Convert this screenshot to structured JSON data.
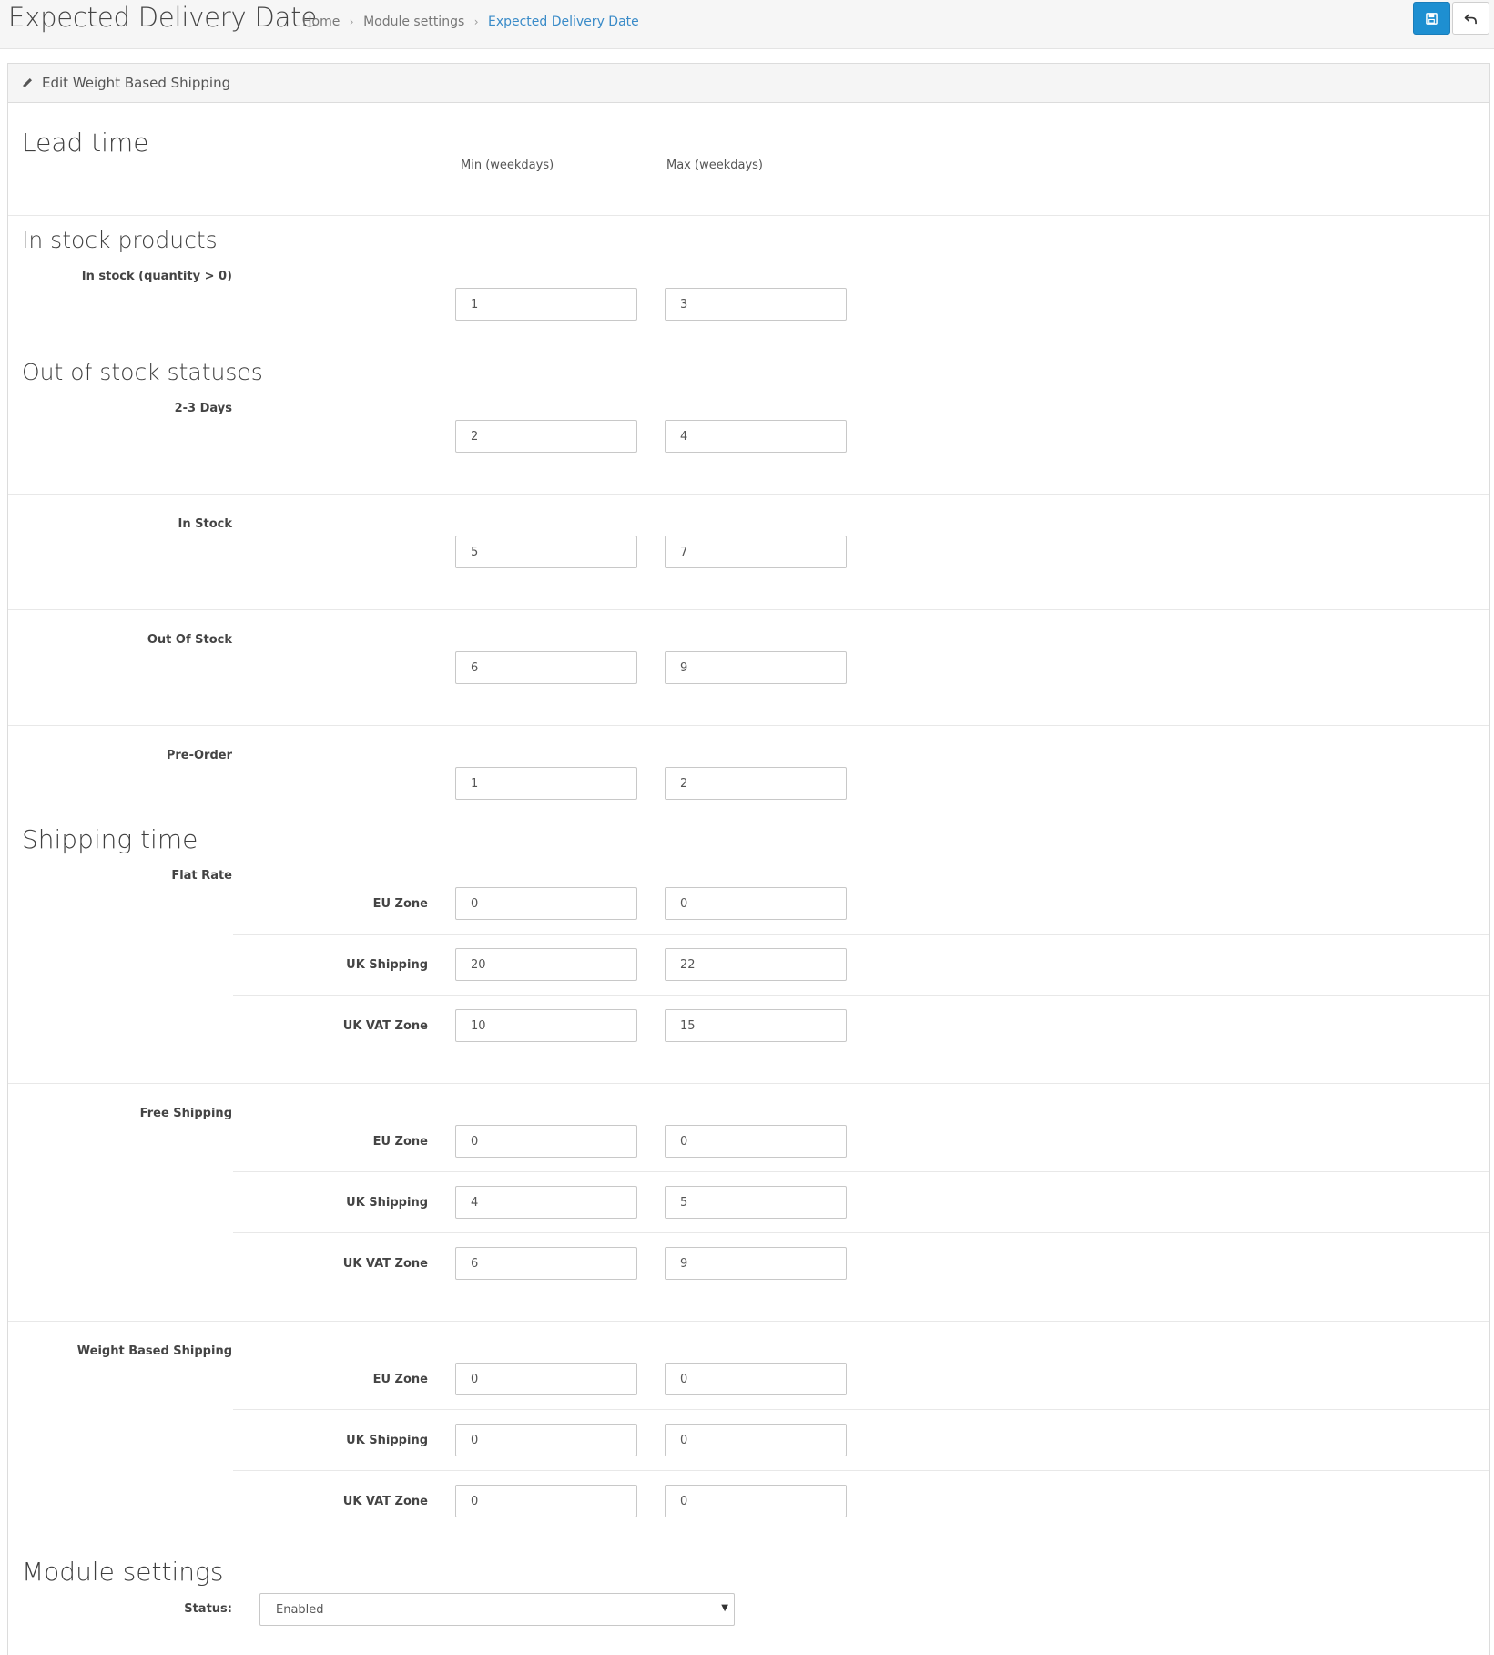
{
  "header": {
    "title": "Expected Delivery Date",
    "breadcrumb": [
      "Home",
      "Module settings",
      "Expected Delivery Date"
    ],
    "save_icon": "floppy-disk-icon",
    "back_icon": "undo-arrow-icon",
    "accent_color": "#1e8fd1",
    "link_color": "#3a8bc8"
  },
  "panel": {
    "heading": "Edit Weight Based Shipping",
    "heading_icon": "pencil-icon"
  },
  "lead_time": {
    "title": "Lead time",
    "min_label": "Min (weekdays)",
    "max_label": "Max (weekdays)"
  },
  "in_stock": {
    "title": "In stock products",
    "rows": [
      {
        "label": "In stock (quantity > 0)",
        "min": "1",
        "max": "3"
      }
    ]
  },
  "out_of_stock": {
    "title": "Out of stock statuses",
    "rows": [
      {
        "label": "2-3 Days",
        "min": "2",
        "max": "4"
      },
      {
        "label": "In Stock",
        "min": "5",
        "max": "7"
      },
      {
        "label": "Out Of Stock",
        "min": "6",
        "max": "9"
      },
      {
        "label": "Pre-Order",
        "min": "1",
        "max": "2"
      }
    ]
  },
  "shipping_time": {
    "title": "Shipping time",
    "carriers": [
      {
        "label": "Flat Rate",
        "zones": [
          {
            "label": "EU Zone",
            "min": "0",
            "max": "0"
          },
          {
            "label": "UK Shipping",
            "min": "20",
            "max": "22"
          },
          {
            "label": "UK VAT Zone",
            "min": "10",
            "max": "15"
          }
        ]
      },
      {
        "label": "Free Shipping",
        "zones": [
          {
            "label": "EU Zone",
            "min": "0",
            "max": "0"
          },
          {
            "label": "UK Shipping",
            "min": "4",
            "max": "5"
          },
          {
            "label": "UK VAT Zone",
            "min": "6",
            "max": "9"
          }
        ]
      },
      {
        "label": "Weight Based Shipping",
        "zones": [
          {
            "label": "EU Zone",
            "min": "0",
            "max": "0"
          },
          {
            "label": "UK Shipping",
            "min": "0",
            "max": "0"
          },
          {
            "label": "UK VAT Zone",
            "min": "0",
            "max": "0"
          }
        ]
      }
    ]
  },
  "module_settings": {
    "title": "Module settings",
    "status_label": "Status:",
    "status_value": "Enabled"
  }
}
